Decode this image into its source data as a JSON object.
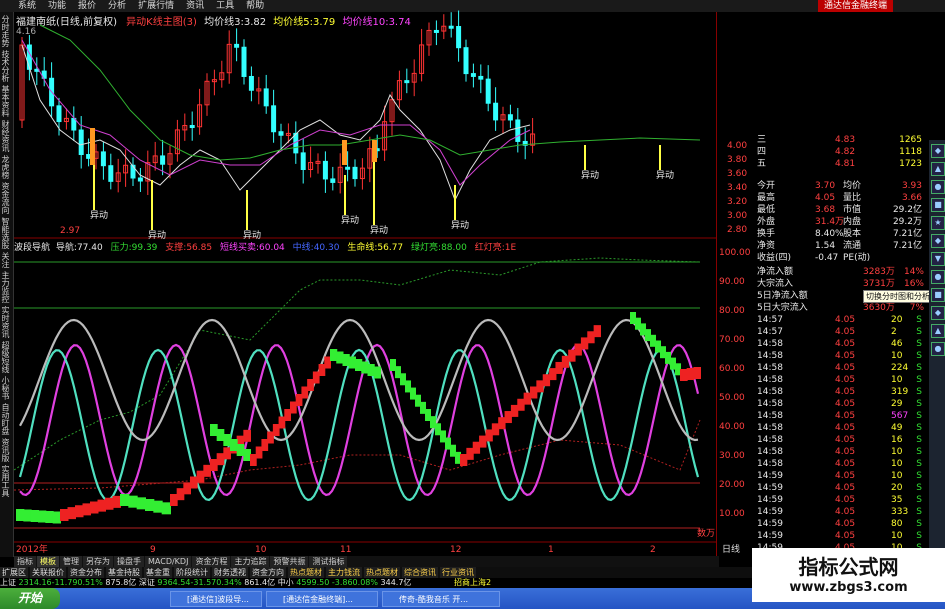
{
  "menu": [
    "系统",
    "功能",
    "报价",
    "分析",
    "扩展行情",
    "资讯",
    "工具",
    "帮助"
  ],
  "menu_brand": "通达信金融终端",
  "left_tabs": [
    "分时走势",
    "技术分析",
    "基本资料",
    "财经资讯",
    "龙虎榜",
    "资金流向",
    "智能选股",
    "关注",
    "主力监控",
    "实时资讯",
    "超级短线",
    "小秘书",
    "自动盯盘",
    "资讯版",
    "实用工具"
  ],
  "main_header": {
    "stock": "福建南纸(日线,前复权)",
    "indicator": "异动K线主图(3)",
    "ma3_label": "均价线3:",
    "ma3": "3.82",
    "ma5_label": "均价线5:",
    "ma5": "3.79",
    "ma10_label": "均价线10:",
    "ma10": "3.74",
    "top_price": "4.16"
  },
  "price_labels": {
    "low": "2.97",
    "event": "异动"
  },
  "sub_header": {
    "name": "波段导航",
    "nav_label": "导航:",
    "nav": "77.40",
    "press_label": "压力:",
    "press": "99.39",
    "support_label": "支撑:",
    "support": "56.85",
    "short_label": "短线买卖:",
    "short": "60.04",
    "mid_label": "中线:",
    "mid": "40.30",
    "life_label": "生命线:",
    "life": "56.77",
    "green_label": "绿灯亮:",
    "green": "88.00",
    "red_label": "红灯亮:",
    "red": "1E"
  },
  "axis_top": [
    "4.00",
    "3.80",
    "3.60",
    "3.40",
    "3.20",
    "3.00",
    "2.80"
  ],
  "axis_bottom": [
    "100.00",
    "90.00",
    "80.00",
    "70.00",
    "60.00",
    "50.00",
    "40.00",
    "30.00",
    "20.00",
    "10.00"
  ],
  "axis_bottom_low": "数万",
  "date_labels": [
    "2012年",
    "9",
    "10",
    "11",
    "12",
    "1",
    "2"
  ],
  "date_tag": "日线",
  "order_book": [
    {
      "label": "三",
      "price": "4.83",
      "vol": "1265"
    },
    {
      "label": "四",
      "price": "4.82",
      "vol": "1118"
    },
    {
      "label": "五",
      "price": "4.81",
      "vol": "1723"
    }
  ],
  "quote": [
    {
      "k1": "今开",
      "v1": "3.70",
      "k2": "均价",
      "v2": "3.93"
    },
    {
      "k1": "最高",
      "v1": "4.05",
      "k2": "量比",
      "v2": "3.66"
    },
    {
      "k1": "最低",
      "v1": "3.68",
      "k2": "市值",
      "v2": "29.2亿"
    },
    {
      "k1": "外盘",
      "v1": "31.4万",
      "k2": "内盘",
      "v2": "29.2万"
    },
    {
      "k1": "换手",
      "v1": "8.40%",
      "k2": "股本",
      "v2": "7.21亿"
    },
    {
      "k1": "净资",
      "v1": "1.54",
      "k2": "流通",
      "v2": "7.21亿"
    },
    {
      "k1": "收益(四)",
      "v1": "-0.47",
      "k2": "PE(动)",
      "v2": ""
    }
  ],
  "flow": [
    {
      "k": "净流入额",
      "v": "3283万",
      "p": "14%"
    },
    {
      "k": "大宗流入",
      "v": "3731万",
      "p": "16%"
    },
    {
      "k": "5日净流入额",
      "v": "",
      "p": ""
    },
    {
      "k": "5日大宗流入",
      "v": "3630万",
      "p": "7%"
    }
  ],
  "tooltip": "切换分时图和分析图",
  "ticks": [
    {
      "t": "14:57",
      "p": "4.05",
      "v": "20",
      "s": "S"
    },
    {
      "t": "14:57",
      "p": "4.05",
      "v": "2",
      "s": "S"
    },
    {
      "t": "14:58",
      "p": "4.05",
      "v": "46",
      "s": "S"
    },
    {
      "t": "14:58",
      "p": "4.05",
      "v": "10",
      "s": "S"
    },
    {
      "t": "14:58",
      "p": "4.05",
      "v": "224",
      "s": "S"
    },
    {
      "t": "14:58",
      "p": "4.05",
      "v": "10",
      "s": "S"
    },
    {
      "t": "14:58",
      "p": "4.05",
      "v": "319",
      "s": "S"
    },
    {
      "t": "14:58",
      "p": "4.05",
      "v": "29",
      "s": "S"
    },
    {
      "t": "14:58",
      "p": "4.05",
      "v": "567",
      "s": "S"
    },
    {
      "t": "14:58",
      "p": "4.05",
      "v": "49",
      "s": "S"
    },
    {
      "t": "14:58",
      "p": "4.05",
      "v": "16",
      "s": "S"
    },
    {
      "t": "14:58",
      "p": "4.05",
      "v": "10",
      "s": "S"
    },
    {
      "t": "14:58",
      "p": "4.05",
      "v": "10",
      "s": "S"
    },
    {
      "t": "14:59",
      "p": "4.05",
      "v": "10",
      "s": "S"
    },
    {
      "t": "14:59",
      "p": "4.05",
      "v": "20",
      "s": "S"
    },
    {
      "t": "14:59",
      "p": "4.05",
      "v": "35",
      "s": "S"
    },
    {
      "t": "14:59",
      "p": "4.05",
      "v": "333",
      "s": "S"
    },
    {
      "t": "14:59",
      "p": "4.05",
      "v": "80",
      "s": "S"
    },
    {
      "t": "14:59",
      "p": "4.05",
      "v": "10",
      "s": "S"
    },
    {
      "t": "14:59",
      "p": "4.05",
      "v": "10",
      "s": "S"
    }
  ],
  "bottom_tabs_1": [
    "指标",
    "模板",
    "管理",
    "另存为",
    "操盘手",
    "MACD/KDJ",
    "资金方程",
    "主力追踪",
    "预警共振",
    "测试指标"
  ],
  "bottom_tabs_2": [
    "扩展区",
    "关联报价",
    "资金分布",
    "基金持股",
    "基金重",
    "阶段统计",
    "财务透视",
    "资金方向",
    "热点题材",
    "主力钱流",
    "热点题材",
    "综合资讯",
    "行业资讯"
  ],
  "status": {
    "sh_label": "上证",
    "sh": "2314.16-11.790.51%",
    "sh_amt": "875.8亿",
    "sz_label": "深证",
    "sz": "9364.54-31.570.34%",
    "sz_amt": "861.4亿",
    "zx_label": "中小",
    "zx": "4599.50 -3.860.08%",
    "zx_amt": "344.7亿",
    "notice": "招商上海2"
  },
  "taskbar": {
    "start": "开始",
    "tasks": [
      "[通达信]波段导...",
      "[通达信金融终端]...",
      "传奇-酷我音乐 开..."
    ]
  },
  "watermark": {
    "line1": "指标公式网",
    "line2": "www.zbgs3.com"
  }
}
